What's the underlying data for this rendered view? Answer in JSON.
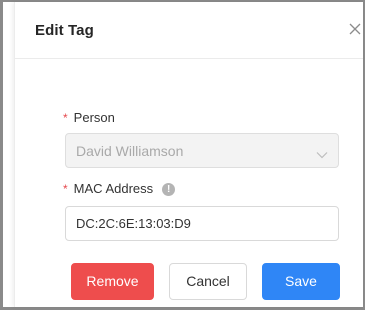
{
  "dialog": {
    "title": "Edit Tag",
    "close_icon": "close-icon"
  },
  "fields": {
    "person": {
      "required_mark": "*",
      "label": "Person",
      "value": "David Williamson",
      "disabled": true,
      "chevron_icon": "chevron-down-icon"
    },
    "mac": {
      "required_mark": "*",
      "label": "MAC Address",
      "info_icon": "info-icon",
      "info_glyph": "!",
      "value": "DC:2C:6E:13:03:D9"
    }
  },
  "buttons": {
    "remove": "Remove",
    "cancel": "Cancel",
    "save": "Save"
  },
  "colors": {
    "danger": "#ee4d4d",
    "primary": "#2f86f6",
    "required": "#e5484d"
  }
}
